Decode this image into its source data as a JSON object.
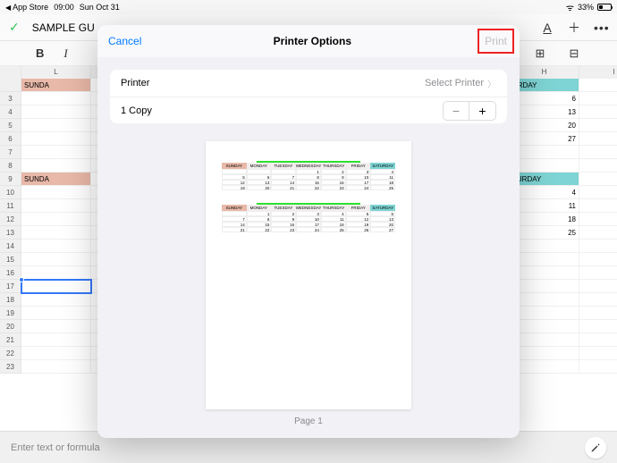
{
  "status": {
    "back_label": "App Store",
    "time": "09:00",
    "date": "Sun Oct 31",
    "battery_pct": "33%"
  },
  "toolbar": {
    "doc_title": "SAMPLE GU"
  },
  "toolbar2": {
    "bold": "B",
    "italic": "I"
  },
  "sheet": {
    "cols": [
      "",
      "L",
      "",
      "",
      "",
      "",
      "",
      "",
      "H",
      "I"
    ],
    "rows": [
      {
        "n": "",
        "cells": [
          "SUNDA",
          "",
          "",
          "",
          "",
          "",
          "",
          "URDAY",
          ""
        ],
        "sun": 0,
        "sat": 7
      },
      {
        "n": "3",
        "cells": [
          "",
          "",
          "",
          "",
          "",
          "",
          "",
          "6",
          ""
        ]
      },
      {
        "n": "4",
        "cells": [
          "",
          "",
          "",
          "",
          "",
          "",
          "",
          "13",
          ""
        ]
      },
      {
        "n": "5",
        "cells": [
          "",
          "",
          "",
          "",
          "",
          "",
          "",
          "20",
          ""
        ]
      },
      {
        "n": "6",
        "cells": [
          "",
          "",
          "",
          "",
          "",
          "",
          "",
          "27",
          ""
        ]
      },
      {
        "n": "7",
        "cells": [
          "",
          "",
          "",
          "",
          "",
          "",
          "",
          "",
          ""
        ]
      },
      {
        "n": "8",
        "cells": [
          "",
          "",
          "",
          "",
          "",
          "",
          "",
          "",
          ""
        ]
      },
      {
        "n": "9",
        "cells": [
          "SUNDA",
          "",
          "",
          "",
          "",
          "",
          "",
          "TURDAY",
          ""
        ],
        "sun": 0,
        "sat": 7
      },
      {
        "n": "10",
        "cells": [
          "",
          "",
          "",
          "",
          "",
          "",
          "",
          "4",
          ""
        ]
      },
      {
        "n": "11",
        "cells": [
          "",
          "",
          "",
          "",
          "",
          "",
          "",
          "11",
          ""
        ]
      },
      {
        "n": "12",
        "cells": [
          "",
          "",
          "",
          "",
          "",
          "",
          "",
          "18",
          ""
        ]
      },
      {
        "n": "13",
        "cells": [
          "",
          "",
          "",
          "",
          "",
          "",
          "",
          "25",
          ""
        ]
      },
      {
        "n": "14",
        "cells": [
          "",
          "",
          "",
          "",
          "",
          "",
          "",
          "",
          ""
        ]
      },
      {
        "n": "15",
        "cells": [
          "",
          "",
          "",
          "",
          "",
          "",
          "",
          "",
          ""
        ]
      },
      {
        "n": "16",
        "cells": [
          "",
          "",
          "",
          "",
          "",
          "",
          "",
          "",
          ""
        ]
      },
      {
        "n": "17",
        "cells": [
          "",
          "",
          "",
          "",
          "",
          "",
          "",
          "",
          ""
        ],
        "selected": 0
      },
      {
        "n": "18",
        "cells": [
          "",
          "",
          "",
          "",
          "",
          "",
          "",
          "",
          ""
        ]
      },
      {
        "n": "19",
        "cells": [
          "",
          "",
          "",
          "",
          "",
          "",
          "",
          "",
          ""
        ]
      },
      {
        "n": "20",
        "cells": [
          "",
          "",
          "",
          "",
          "",
          "",
          "",
          "",
          ""
        ]
      },
      {
        "n": "21",
        "cells": [
          "",
          "",
          "",
          "",
          "",
          "",
          "",
          "",
          ""
        ]
      },
      {
        "n": "22",
        "cells": [
          "",
          "",
          "",
          "",
          "",
          "",
          "",
          "",
          ""
        ]
      },
      {
        "n": "23",
        "cells": [
          "",
          "",
          "",
          "",
          "",
          "",
          "",
          "",
          ""
        ]
      }
    ]
  },
  "formula_placeholder": "Enter text or formula",
  "modal": {
    "cancel": "Cancel",
    "title": "Printer Options",
    "print": "Print",
    "printer_label": "Printer",
    "printer_value": "Select Printer",
    "copies_label": "1 Copy",
    "page_label": "Page 1",
    "preview": {
      "days": [
        "SUNDAY",
        "MONDAY",
        "TUESDAY",
        "WEDNESDAY",
        "THURSDAY",
        "FRIDAY",
        "SATURDAY"
      ],
      "cal1": [
        [
          "",
          "",
          "",
          "1",
          "2",
          "3",
          "4"
        ],
        [
          "5",
          "6",
          "7",
          "8",
          "9",
          "10",
          "11"
        ],
        [
          "12",
          "13",
          "14",
          "15",
          "16",
          "17",
          "18"
        ],
        [
          "19",
          "20",
          "21",
          "22",
          "23",
          "24",
          "25"
        ]
      ],
      "cal2": [
        [
          "",
          "1",
          "2",
          "3",
          "4",
          "5",
          "6"
        ],
        [
          "7",
          "8",
          "9",
          "10",
          "11",
          "12",
          "13"
        ],
        [
          "14",
          "15",
          "16",
          "17",
          "18",
          "19",
          "20"
        ],
        [
          "21",
          "22",
          "23",
          "24",
          "25",
          "26",
          "27"
        ]
      ]
    }
  }
}
